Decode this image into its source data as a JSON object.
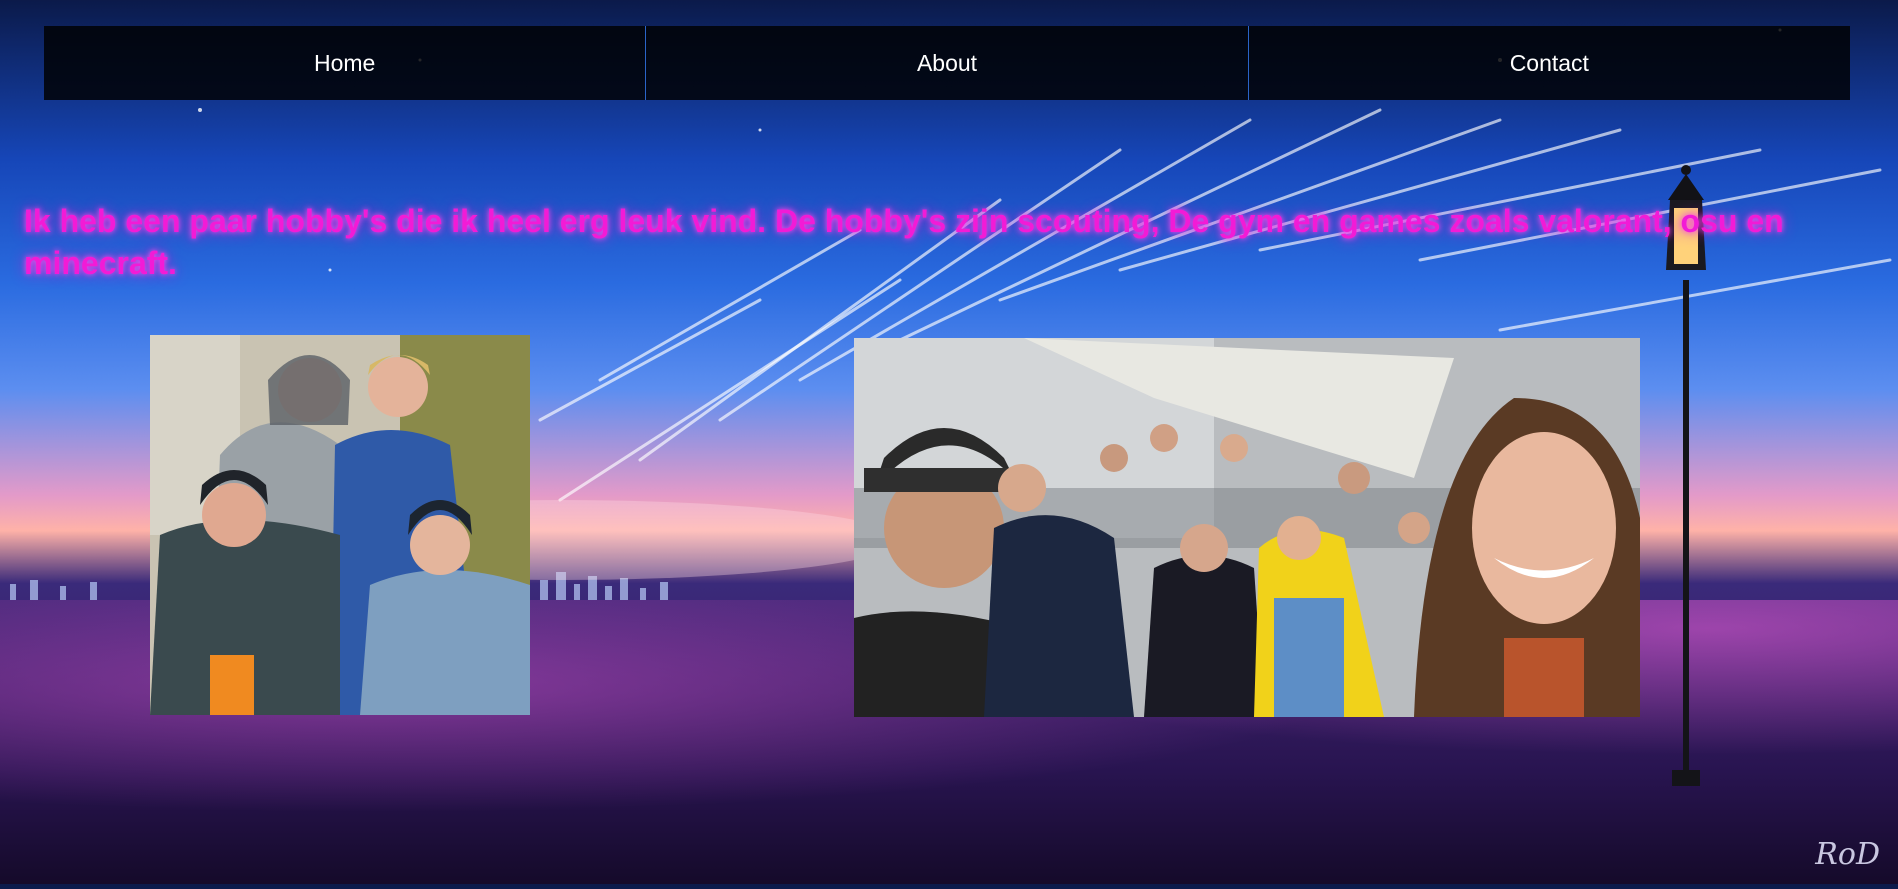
{
  "nav": {
    "items": [
      {
        "label": "Home"
      },
      {
        "label": "About"
      },
      {
        "label": "Contact"
      }
    ]
  },
  "intro": {
    "text": "Ik heb een paar hobby's die ik heel erg leuk vind. De hobby's zijn scouting, De gym en games zoals valorant, osu en minecraft."
  },
  "signature": {
    "text": "RoD"
  },
  "colors": {
    "nav_bg": "#000000",
    "nav_divider": "#2a64c8",
    "intro_text": "#f21bd6"
  }
}
